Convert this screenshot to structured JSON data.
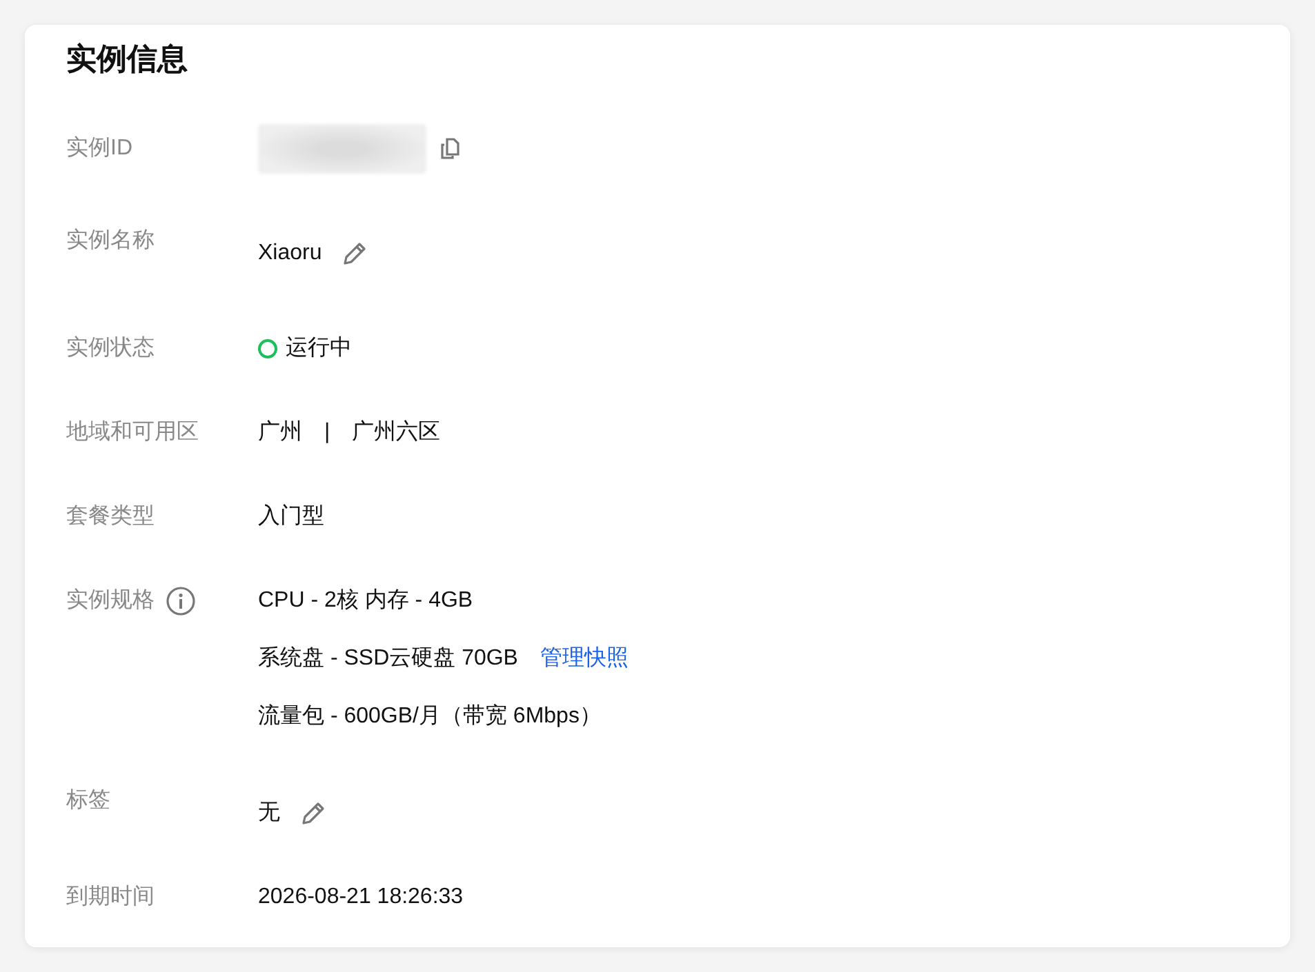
{
  "title": "实例信息",
  "rows": [
    {
      "kind": "redacted",
      "label": "实例ID"
    },
    {
      "kind": "editable",
      "label": "实例名称",
      "value": "Xiaoru"
    },
    {
      "kind": "status",
      "label": "实例状态",
      "value": "运行中",
      "color": "#1cbf5a"
    },
    {
      "kind": "pair",
      "label": "地域和可用区",
      "parts": [
        "广州",
        "|",
        "广州六区"
      ]
    },
    {
      "kind": "text",
      "label": "套餐类型",
      "value": "入门型"
    },
    {
      "kind": "spec",
      "label": "实例规格",
      "lines": [
        "CPU - 2核 内存 - 4GB",
        "系统盘 - SSD云硬盘 70GB",
        "流量包 - 600GB/月（带宽 6Mbps）"
      ],
      "link": "管理快照"
    },
    {
      "kind": "editable",
      "label": "标签",
      "value": "无"
    },
    {
      "kind": "text",
      "label": "到期时间",
      "value": "2026-08-21 18:26:33"
    }
  ]
}
